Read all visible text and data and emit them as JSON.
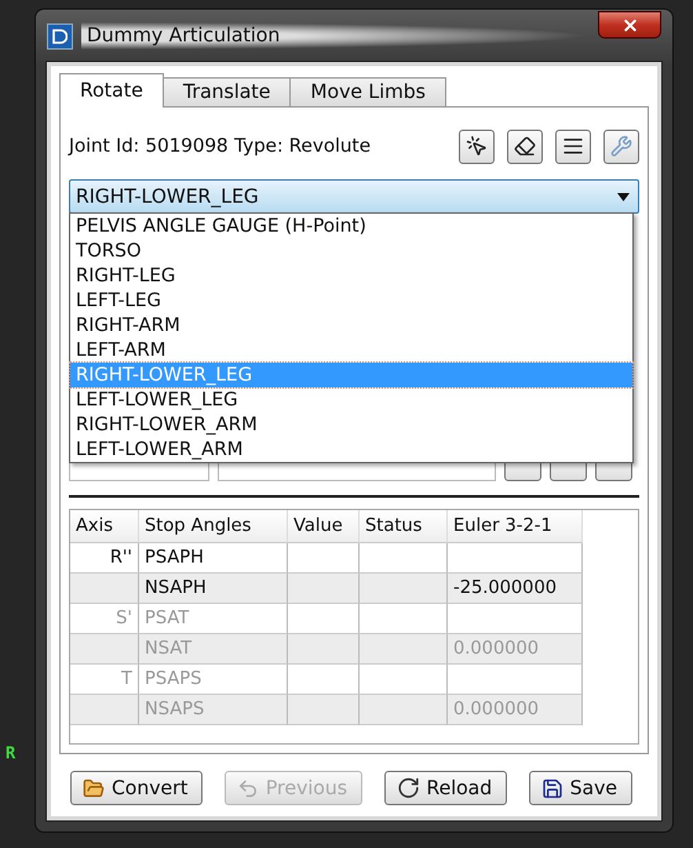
{
  "window": {
    "title": "Dummy Articulation"
  },
  "tabs": [
    {
      "label": "Rotate",
      "selected": true
    },
    {
      "label": "Translate",
      "selected": false
    },
    {
      "label": "Move Limbs",
      "selected": false
    }
  ],
  "joint_info": "Joint Id: 5019098 Type: Revolute",
  "toolbar": [
    {
      "kind": "pick",
      "disabled": false
    },
    {
      "kind": "eraser",
      "disabled": false
    },
    {
      "kind": "list",
      "disabled": false
    },
    {
      "kind": "tools",
      "disabled": true
    }
  ],
  "segment_select": {
    "value": "RIGHT-LOWER_LEG",
    "options": [
      {
        "label": "PELVIS ANGLE GAUGE  (H-Point)",
        "selected": false
      },
      {
        "label": "TORSO",
        "selected": false
      },
      {
        "label": "RIGHT-LEG",
        "selected": false
      },
      {
        "label": "LEFT-LEG",
        "selected": false
      },
      {
        "label": "RIGHT-ARM",
        "selected": false
      },
      {
        "label": "LEFT-ARM",
        "selected": false
      },
      {
        "label": "RIGHT-LOWER_LEG",
        "selected": true
      },
      {
        "label": "LEFT-LOWER_LEG",
        "selected": false
      },
      {
        "label": "RIGHT-LOWER_ARM",
        "selected": false
      },
      {
        "label": "LEFT-LOWER_ARM",
        "selected": false
      }
    ]
  },
  "table": {
    "columns": [
      "Axis",
      "Stop Angles",
      "Value",
      "Status",
      "Euler 3-2-1"
    ],
    "rows": [
      {
        "axis": "R''",
        "stop": "PSAPH",
        "euler": "",
        "disabled": false
      },
      {
        "axis": "",
        "stop": "NSAPH",
        "euler": "-25.000000",
        "disabled": false
      },
      {
        "axis": "S'",
        "stop": "PSAT",
        "euler": "",
        "disabled": true
      },
      {
        "axis": "",
        "stop": "NSAT",
        "euler": "0.000000",
        "disabled": true
      },
      {
        "axis": "T",
        "stop": "PSAPS",
        "euler": "",
        "disabled": true
      },
      {
        "axis": "",
        "stop": "NSAPS",
        "euler": "0.000000",
        "disabled": true
      }
    ]
  },
  "buttons": [
    {
      "kind": "convert",
      "label": "Convert",
      "disabled": false
    },
    {
      "kind": "previous",
      "label": "Previous",
      "disabled": true
    },
    {
      "kind": "reload",
      "label": "Reload",
      "disabled": false
    },
    {
      "kind": "save",
      "label": "Save",
      "disabled": false
    }
  ],
  "background_label": "R"
}
